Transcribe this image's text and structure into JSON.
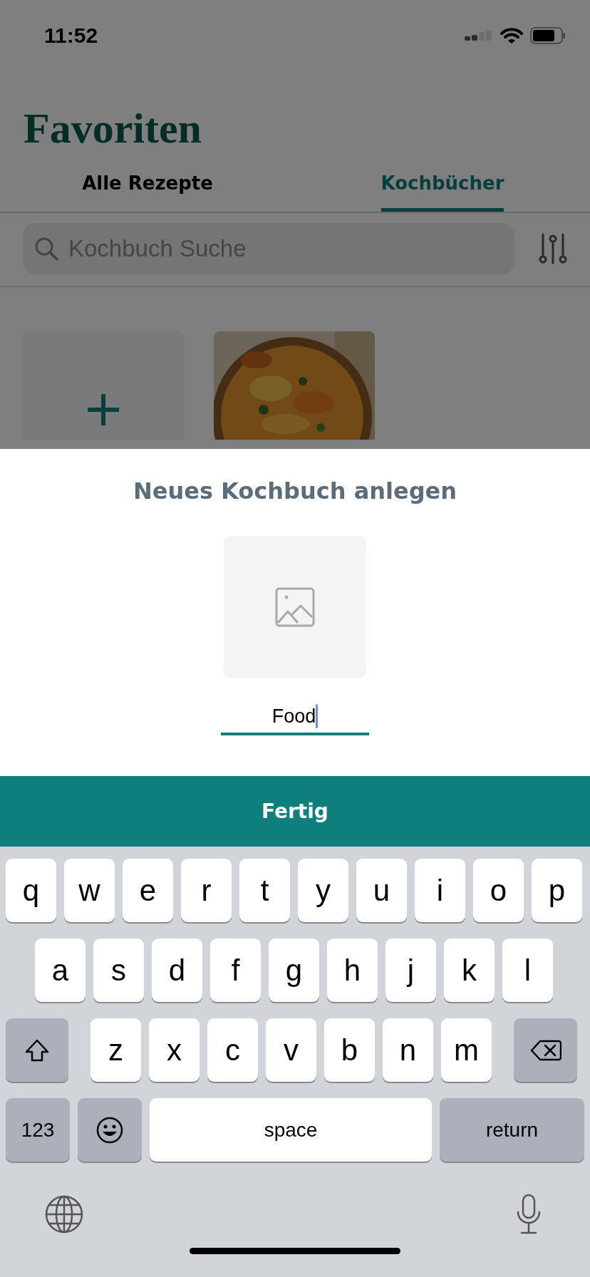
{
  "status_bar": {
    "time": "11:52"
  },
  "title": "Favoriten",
  "tabs": [
    {
      "label": "Alle Rezepte",
      "selected": false
    },
    {
      "label": "Kochbücher",
      "selected": true
    }
  ],
  "search": {
    "placeholder": "Kochbuch Suche"
  },
  "cookbooks": [
    {
      "kind": "add"
    },
    {
      "kind": "picture"
    }
  ],
  "sheet": {
    "title": "Neues Kochbuch anlegen",
    "name_field": {
      "value": "Food"
    },
    "done_button": "Fertig"
  },
  "keyboard": {
    "rows": [
      [
        {
          "kind": "letter",
          "label": "q"
        },
        {
          "kind": "letter",
          "label": "w"
        },
        {
          "kind": "letter",
          "label": "e"
        },
        {
          "kind": "letter",
          "label": "r"
        },
        {
          "kind": "letter",
          "label": "t"
        },
        {
          "kind": "letter",
          "label": "y"
        },
        {
          "kind": "letter",
          "label": "u"
        },
        {
          "kind": "letter",
          "label": "i"
        },
        {
          "kind": "letter",
          "label": "o"
        },
        {
          "kind": "letter",
          "label": "p"
        }
      ],
      [
        {
          "kind": "letter",
          "label": "a"
        },
        {
          "kind": "letter",
          "label": "s"
        },
        {
          "kind": "letter",
          "label": "d"
        },
        {
          "kind": "letter",
          "label": "f"
        },
        {
          "kind": "letter",
          "label": "g"
        },
        {
          "kind": "letter",
          "label": "h"
        },
        {
          "kind": "letter",
          "label": "j"
        },
        {
          "kind": "letter",
          "label": "k"
        },
        {
          "kind": "letter",
          "label": "l"
        }
      ],
      [
        {
          "kind": "shift"
        },
        {
          "kind": "letter",
          "label": "z"
        },
        {
          "kind": "letter",
          "label": "x"
        },
        {
          "kind": "letter",
          "label": "c"
        },
        {
          "kind": "letter",
          "label": "v"
        },
        {
          "kind": "letter",
          "label": "b"
        },
        {
          "kind": "letter",
          "label": "n"
        },
        {
          "kind": "letter",
          "label": "m"
        },
        {
          "kind": "backspace"
        }
      ]
    ],
    "bottom_keys": {
      "numbers": "123",
      "space": "space",
      "return": "return"
    }
  }
}
